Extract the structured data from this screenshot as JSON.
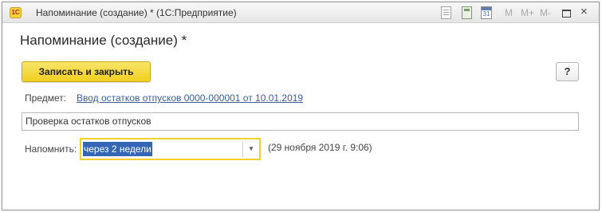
{
  "window": {
    "app_icon_text": "1С",
    "title": "Напоминание (создание) *  (1С:Предприятие)",
    "toolbar": {
      "m_label": "M",
      "mplus_label": "M+",
      "mminus_label": "M-",
      "calendar_day": "31",
      "close_glyph": "×",
      "icons": [
        "document-icon",
        "calculator-icon",
        "calendar-icon",
        "memory-icon",
        "memory-plus-icon",
        "memory-minus-icon",
        "maximize-icon",
        "close-icon"
      ]
    }
  },
  "form": {
    "title": "Напоминание (создание) *",
    "save_close_label": "Записать и закрыть",
    "help_label": "?",
    "subject_label": "Предмет:",
    "subject_link": "Ввод остатков отпусков 0000-000001 от 10.01.2019",
    "description_value": "Проверка остатков отпусков",
    "remind_label": "Напомнить:",
    "remind_value": "через 2 недели",
    "remind_dropdown_glyph": "▼",
    "remind_datetime": "(29 ноября 2019 г. 9:06)"
  },
  "colors": {
    "accent_button": "#f0cf20",
    "focus_border": "#f2d02c",
    "selection": "#3367b5",
    "link": "#3b5d98"
  }
}
